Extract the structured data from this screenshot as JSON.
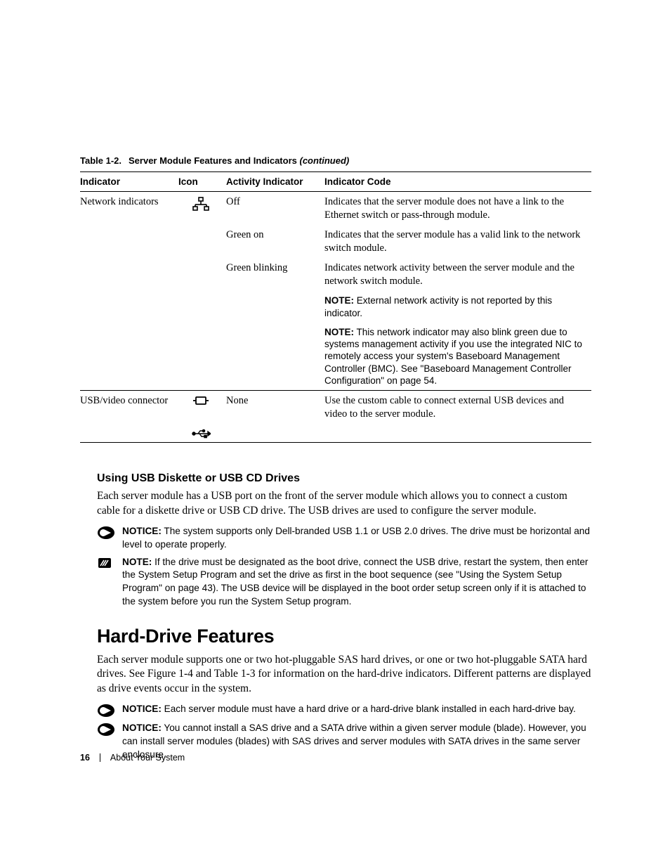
{
  "table": {
    "caption_prefix": "Table 1-2.",
    "caption_title": "Server Module Features and Indicators ",
    "caption_suffix": "(continued)",
    "headers": {
      "indicator": "Indicator",
      "icon": "Icon",
      "activity": "Activity Indicator",
      "code": "Indicator Code"
    },
    "rows": {
      "net": {
        "indicator": "Network indicators",
        "r1": {
          "activity": "Off",
          "code": "Indicates that the server module does not have a link to the Ethernet switch or pass-through module."
        },
        "r2": {
          "activity": "Green on",
          "code": "Indicates that the server module has a valid link to the network switch module."
        },
        "r3": {
          "activity": "Green blinking",
          "code": "Indicates network activity between the server module and the network switch module."
        },
        "note1": {
          "label": "NOTE:",
          "text": " External network activity is not reported by this indicator."
        },
        "note2": {
          "label": "NOTE:",
          "text": " This network indicator may also blink green due to systems management activity if you use the integrated NIC to remotely access your system's Baseboard Management Controller (BMC). See \"Baseboard Management Controller Configuration\" on page 54."
        }
      },
      "usb": {
        "indicator": "USB/video connector",
        "activity": "None",
        "code": "Use the custom cable to connect external USB devices and video to the server module."
      }
    }
  },
  "usb_section": {
    "heading": "Using USB Diskette or USB CD Drives",
    "para": "Each server module has a USB port on the front of the server module which allows you to connect a custom cable for a diskette drive or USB CD drive. The USB drives are used to configure the server module.",
    "notice1": {
      "label": "NOTICE:",
      "text": " The system supports only Dell-branded USB 1.1 or USB 2.0 drives. The drive must be horizontal and level to operate properly."
    },
    "note1": {
      "label": "NOTE:",
      "text": " If the drive must be designated as the boot drive, connect the USB drive, restart the system, then enter the System Setup Program and set the drive as first in the boot sequence (see \"Using the System Setup Program\" on page 43). The USB device will be displayed in the boot order setup screen only if it is attached to the system before you run the System Setup program."
    }
  },
  "hdd_section": {
    "heading": "Hard-Drive Features",
    "para": "Each server module supports one or two hot-pluggable SAS hard drives, or one or two hot-pluggable SATA hard drives. See Figure 1-4 and Table 1-3 for information on the hard-drive indicators. Different patterns are displayed as drive events occur in the system.",
    "notice1": {
      "label": "NOTICE:",
      "text": " Each server module must have a hard drive or a hard-drive blank installed in each hard-drive bay."
    },
    "notice2": {
      "label": "NOTICE:",
      "text": " You cannot install a SAS drive and a SATA drive within a given server module (blade). However, you can install server modules (blades) with SAS drives and server modules with SATA drives in the same server enclosure."
    }
  },
  "footer": {
    "page": "16",
    "section": "About Your System"
  }
}
